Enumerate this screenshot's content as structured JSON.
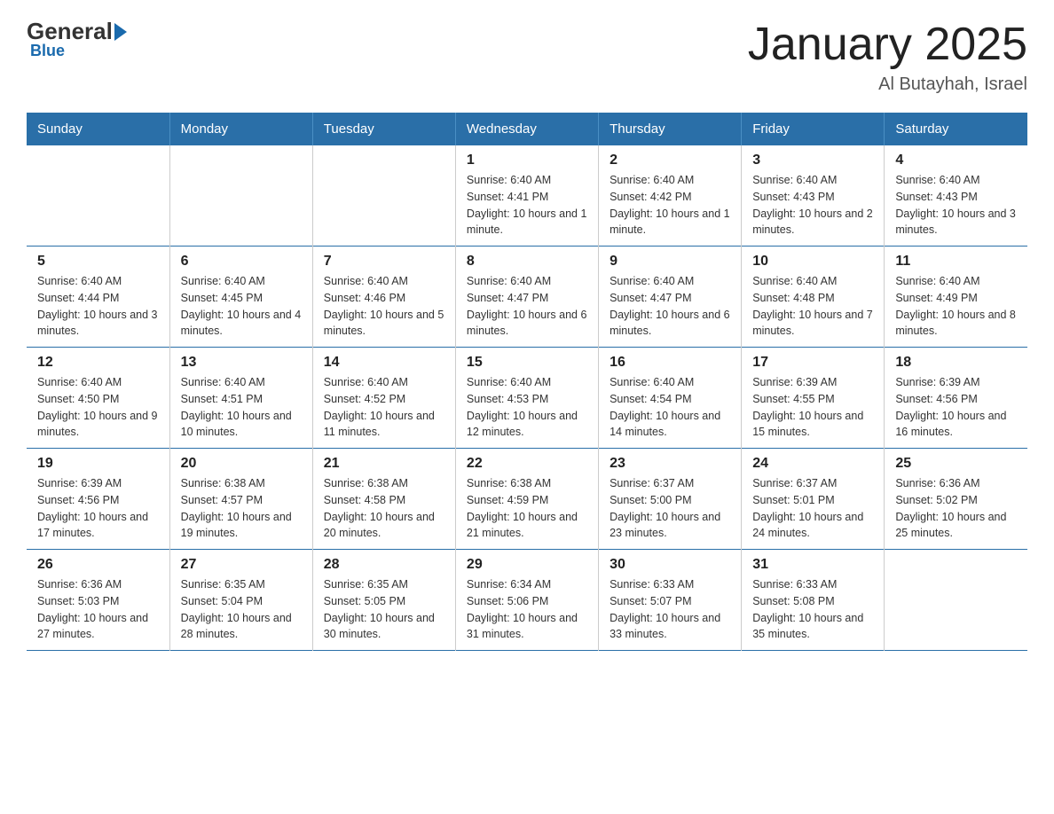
{
  "logo": {
    "general": "General",
    "blue": "Blue"
  },
  "header": {
    "title": "January 2025",
    "location": "Al Butayhah, Israel"
  },
  "weekdays": [
    "Sunday",
    "Monday",
    "Tuesday",
    "Wednesday",
    "Thursday",
    "Friday",
    "Saturday"
  ],
  "weeks": [
    [
      {
        "day": "",
        "info": ""
      },
      {
        "day": "",
        "info": ""
      },
      {
        "day": "",
        "info": ""
      },
      {
        "day": "1",
        "info": "Sunrise: 6:40 AM\nSunset: 4:41 PM\nDaylight: 10 hours and 1 minute."
      },
      {
        "day": "2",
        "info": "Sunrise: 6:40 AM\nSunset: 4:42 PM\nDaylight: 10 hours and 1 minute."
      },
      {
        "day": "3",
        "info": "Sunrise: 6:40 AM\nSunset: 4:43 PM\nDaylight: 10 hours and 2 minutes."
      },
      {
        "day": "4",
        "info": "Sunrise: 6:40 AM\nSunset: 4:43 PM\nDaylight: 10 hours and 3 minutes."
      }
    ],
    [
      {
        "day": "5",
        "info": "Sunrise: 6:40 AM\nSunset: 4:44 PM\nDaylight: 10 hours and 3 minutes."
      },
      {
        "day": "6",
        "info": "Sunrise: 6:40 AM\nSunset: 4:45 PM\nDaylight: 10 hours and 4 minutes."
      },
      {
        "day": "7",
        "info": "Sunrise: 6:40 AM\nSunset: 4:46 PM\nDaylight: 10 hours and 5 minutes."
      },
      {
        "day": "8",
        "info": "Sunrise: 6:40 AM\nSunset: 4:47 PM\nDaylight: 10 hours and 6 minutes."
      },
      {
        "day": "9",
        "info": "Sunrise: 6:40 AM\nSunset: 4:47 PM\nDaylight: 10 hours and 6 minutes."
      },
      {
        "day": "10",
        "info": "Sunrise: 6:40 AM\nSunset: 4:48 PM\nDaylight: 10 hours and 7 minutes."
      },
      {
        "day": "11",
        "info": "Sunrise: 6:40 AM\nSunset: 4:49 PM\nDaylight: 10 hours and 8 minutes."
      }
    ],
    [
      {
        "day": "12",
        "info": "Sunrise: 6:40 AM\nSunset: 4:50 PM\nDaylight: 10 hours and 9 minutes."
      },
      {
        "day": "13",
        "info": "Sunrise: 6:40 AM\nSunset: 4:51 PM\nDaylight: 10 hours and 10 minutes."
      },
      {
        "day": "14",
        "info": "Sunrise: 6:40 AM\nSunset: 4:52 PM\nDaylight: 10 hours and 11 minutes."
      },
      {
        "day": "15",
        "info": "Sunrise: 6:40 AM\nSunset: 4:53 PM\nDaylight: 10 hours and 12 minutes."
      },
      {
        "day": "16",
        "info": "Sunrise: 6:40 AM\nSunset: 4:54 PM\nDaylight: 10 hours and 14 minutes."
      },
      {
        "day": "17",
        "info": "Sunrise: 6:39 AM\nSunset: 4:55 PM\nDaylight: 10 hours and 15 minutes."
      },
      {
        "day": "18",
        "info": "Sunrise: 6:39 AM\nSunset: 4:56 PM\nDaylight: 10 hours and 16 minutes."
      }
    ],
    [
      {
        "day": "19",
        "info": "Sunrise: 6:39 AM\nSunset: 4:56 PM\nDaylight: 10 hours and 17 minutes."
      },
      {
        "day": "20",
        "info": "Sunrise: 6:38 AM\nSunset: 4:57 PM\nDaylight: 10 hours and 19 minutes."
      },
      {
        "day": "21",
        "info": "Sunrise: 6:38 AM\nSunset: 4:58 PM\nDaylight: 10 hours and 20 minutes."
      },
      {
        "day": "22",
        "info": "Sunrise: 6:38 AM\nSunset: 4:59 PM\nDaylight: 10 hours and 21 minutes."
      },
      {
        "day": "23",
        "info": "Sunrise: 6:37 AM\nSunset: 5:00 PM\nDaylight: 10 hours and 23 minutes."
      },
      {
        "day": "24",
        "info": "Sunrise: 6:37 AM\nSunset: 5:01 PM\nDaylight: 10 hours and 24 minutes."
      },
      {
        "day": "25",
        "info": "Sunrise: 6:36 AM\nSunset: 5:02 PM\nDaylight: 10 hours and 25 minutes."
      }
    ],
    [
      {
        "day": "26",
        "info": "Sunrise: 6:36 AM\nSunset: 5:03 PM\nDaylight: 10 hours and 27 minutes."
      },
      {
        "day": "27",
        "info": "Sunrise: 6:35 AM\nSunset: 5:04 PM\nDaylight: 10 hours and 28 minutes."
      },
      {
        "day": "28",
        "info": "Sunrise: 6:35 AM\nSunset: 5:05 PM\nDaylight: 10 hours and 30 minutes."
      },
      {
        "day": "29",
        "info": "Sunrise: 6:34 AM\nSunset: 5:06 PM\nDaylight: 10 hours and 31 minutes."
      },
      {
        "day": "30",
        "info": "Sunrise: 6:33 AM\nSunset: 5:07 PM\nDaylight: 10 hours and 33 minutes."
      },
      {
        "day": "31",
        "info": "Sunrise: 6:33 AM\nSunset: 5:08 PM\nDaylight: 10 hours and 35 minutes."
      },
      {
        "day": "",
        "info": ""
      }
    ]
  ]
}
